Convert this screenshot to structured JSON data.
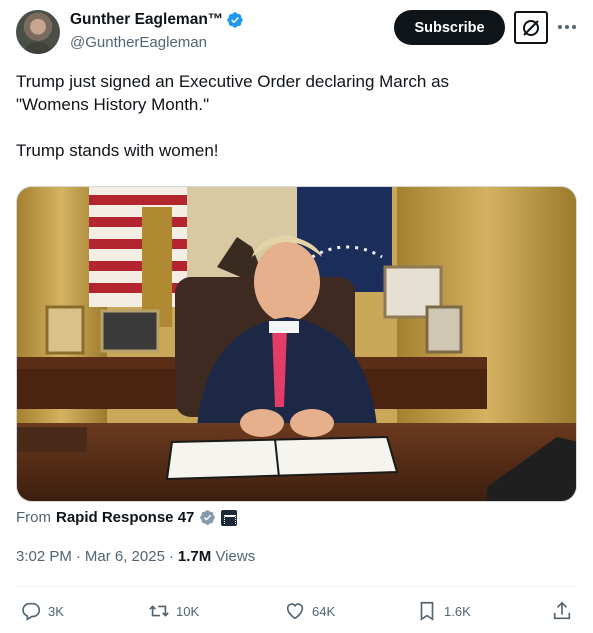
{
  "author": {
    "display_name": "Gunther Eagleman™",
    "handle": "@GuntherEagleman",
    "verified": true
  },
  "header_actions": {
    "subscribe_label": "Subscribe",
    "grok_icon": "grok-icon",
    "more_icon": "more-icon"
  },
  "tweet": {
    "lines": [
      "Trump just signed an Executive Order declaring March as",
      "\"Womens History Month.\"",
      "Trump stands with women!"
    ]
  },
  "media": {
    "kind": "video-still"
  },
  "source": {
    "from_label": "From",
    "name": "Rapid Response 47"
  },
  "meta": {
    "time": "3:02 PM",
    "separator": "·",
    "date": "Mar 6, 2025",
    "views_count": "1.7M",
    "views_label": "Views"
  },
  "engagement": {
    "replies": "3K",
    "reposts": "10K",
    "likes": "64K",
    "bookmarks": "1.6K"
  },
  "colors": {
    "verified_blue": "#1d9bf0",
    "text_primary": "#0f1419",
    "text_secondary": "#536471"
  }
}
